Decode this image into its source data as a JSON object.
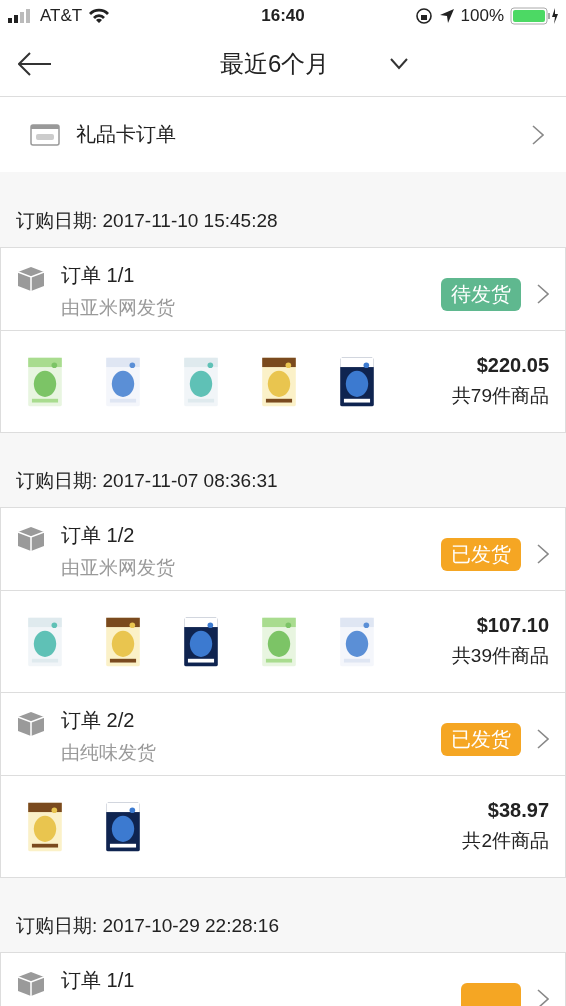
{
  "status_bar": {
    "carrier": "AT&T",
    "time": "16:40",
    "battery": "100%"
  },
  "nav": {
    "title": "最近6个月"
  },
  "gift_card": {
    "label": "礼品卡订单"
  },
  "groups": [
    {
      "date": "订购日期: 2017-11-10 15:45:28",
      "orders": [
        {
          "title": "订单 1/1",
          "seller": "由亚米网发货",
          "status": "待发货",
          "color": "#5fb88f",
          "price": "$220.05",
          "count": "共79件商品"
        }
      ]
    },
    {
      "date": "订购日期: 2017-11-07 08:36:31",
      "orders": [
        {
          "title": "订单 1/2",
          "seller": "由亚米网发货",
          "status": "已发货",
          "color": "#f5a623",
          "price": "$107.10",
          "count": "共39件商品"
        },
        {
          "title": "订单 2/2",
          "seller": "由纯味发货",
          "status": "已发货",
          "color": "#f5a623",
          "price": "$38.97",
          "count": "共2件商品"
        }
      ]
    },
    {
      "date": "订购日期: 2017-10-29 22:28:16",
      "orders": [
        {
          "title": "订单 1/1",
          "color": "#f5a623"
        }
      ]
    }
  ]
}
